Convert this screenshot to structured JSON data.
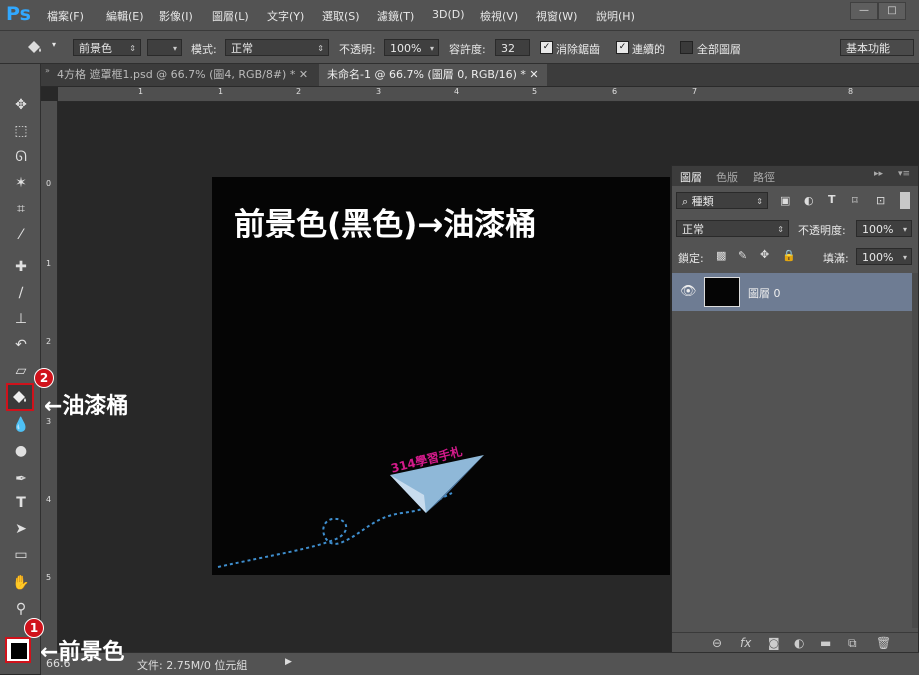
{
  "app": {
    "logo": "Ps"
  },
  "menu": [
    "檔案(F)",
    "編輯(E)",
    "影像(I)",
    "圖層(L)",
    "文字(Y)",
    "選取(S)",
    "濾鏡(T)",
    "3D(D)",
    "檢視(V)",
    "視窗(W)",
    "說明(H)"
  ],
  "window_buttons": [
    "—",
    "□"
  ],
  "options": {
    "fill_source": "前景色",
    "mode_label": "模式:",
    "mode_value": "正常",
    "opacity_label": "不透明:",
    "opacity_value": "100%",
    "tolerance_label": "容許度:",
    "tolerance_value": "32",
    "antialias_label": "消除鋸齒",
    "contiguous_label": "連續的",
    "all_layers_label": "全部圖層",
    "workspace": "基本功能"
  },
  "tabs": [
    {
      "label": "4方格 遮罩框1.psd @ 66.7% (圖4, RGB/8#) *"
    },
    {
      "label": "未命名-1 @ 66.7% (圖層 0, RGB/16) *"
    }
  ],
  "ruler_h": [
    "1",
    "1",
    "2",
    "3",
    "4",
    "5",
    "6",
    "7",
    "8"
  ],
  "ruler_v": [
    "0",
    "1",
    "2",
    "3",
    "4",
    "5",
    "6"
  ],
  "canvas": {
    "title": "前景色(黑色)→油漆桶",
    "brand": "314學習手札"
  },
  "layers_panel": {
    "tabs": [
      "圖層",
      "色版",
      "路徑"
    ],
    "filter": "種類",
    "blend_mode": "正常",
    "opacity_label": "不透明度:",
    "opacity_value": "100%",
    "lock_label": "鎖定:",
    "fill_label": "填滿:",
    "fill_value": "100%",
    "layer_name": "圖層 0"
  },
  "status": {
    "zoom": "66.6",
    "doc_info": "文件: 2.75M/0 位元組"
  },
  "annotations": {
    "paint_bucket": "←油漆桶",
    "foreground": "←前景色",
    "badge_1": "1",
    "badge_2": "2"
  },
  "colors": {
    "foreground_swatch": "#000000",
    "highlight": "#d0121b",
    "layer_selected": "#6e7c93"
  }
}
